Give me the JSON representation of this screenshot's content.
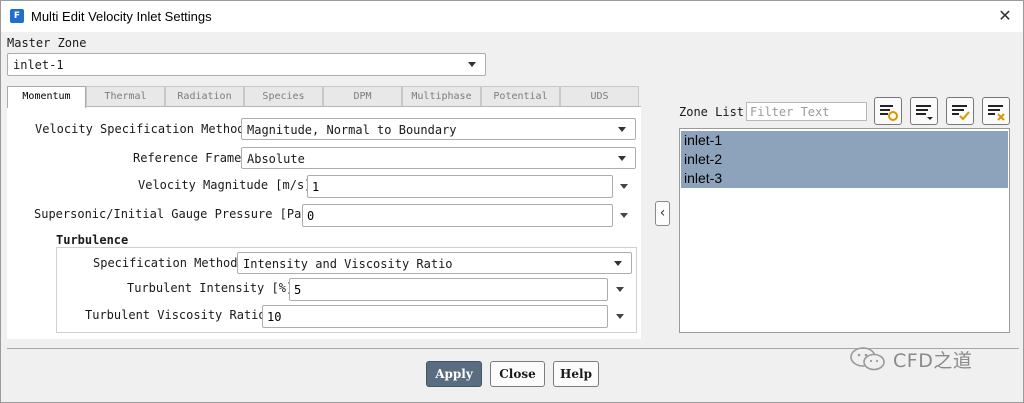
{
  "window": {
    "title": "Multi Edit Velocity Inlet Settings"
  },
  "master_zone": {
    "label": "Master Zone",
    "value": "inlet-1"
  },
  "tabs": [
    {
      "label": "Momentum",
      "active": true
    },
    {
      "label": "Thermal"
    },
    {
      "label": "Radiation"
    },
    {
      "label": "Species"
    },
    {
      "label": "DPM"
    },
    {
      "label": "Multiphase"
    },
    {
      "label": "Potential"
    },
    {
      "label": "UDS"
    }
  ],
  "momentum": {
    "velocity_spec_method": {
      "label": "Velocity Specification Method",
      "value": "Magnitude, Normal to Boundary"
    },
    "reference_frame": {
      "label": "Reference Frame",
      "value": "Absolute"
    },
    "velocity_magnitude": {
      "label": "Velocity Magnitude [m/s]",
      "value": "1"
    },
    "gauge_pressure": {
      "label": "Supersonic/Initial Gauge Pressure [Pa]",
      "value": "0"
    },
    "turbulence": {
      "title": "Turbulence",
      "spec_method": {
        "label": "Specification Method",
        "value": "Intensity and Viscosity Ratio"
      },
      "intensity": {
        "label": "Turbulent Intensity [%]",
        "value": "5"
      },
      "viscosity_ratio": {
        "label": "Turbulent Viscosity Ratio",
        "value": "10"
      }
    }
  },
  "zone_list": {
    "label": "Zone List",
    "filter_placeholder": "Filter Text",
    "items": [
      "inlet-1",
      "inlet-2",
      "inlet-3"
    ],
    "selected_all": true
  },
  "buttons": {
    "apply": "Apply",
    "close": "Close",
    "help": "Help"
  },
  "watermark": {
    "text": "CFD之道"
  },
  "colors": {
    "selection": "#8ca3bb",
    "apply_button": "#5a6d80",
    "app_icon": "#1f6fd1"
  },
  "icons": [
    "select-all-icon",
    "deselect-icon",
    "select-checked-icon",
    "clear-selection-icon",
    "collapse-left-icon",
    "close-icon",
    "wechat-icon"
  ]
}
